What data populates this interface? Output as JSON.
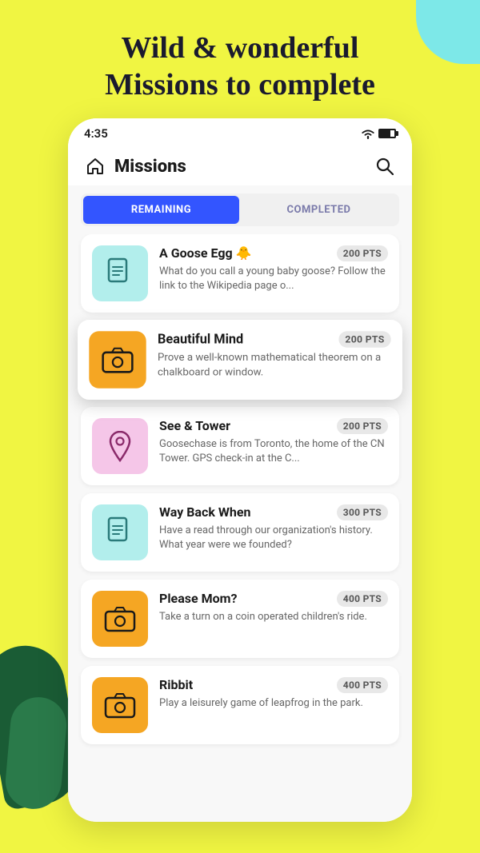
{
  "page": {
    "background_color": "#f0f542",
    "header": {
      "title_line1": "Wild & wonderful",
      "title_line2": "Missions to complete"
    },
    "status_bar": {
      "time": "4:35"
    },
    "app_header": {
      "title": "Missions"
    },
    "tabs": {
      "remaining_label": "REMAINING",
      "completed_label": "COMPLETED",
      "active": "remaining"
    },
    "missions": [
      {
        "id": "goose-egg",
        "title": "A Goose Egg 🐥",
        "pts": "200 PTS",
        "description": "What do you call a young baby goose? Follow the link to the Wikipedia page o...",
        "icon_type": "document",
        "icon_bg": "teal",
        "highlighted": false
      },
      {
        "id": "beautiful-mind",
        "title": "Beautiful Mind",
        "pts": "200 PTS",
        "description": "Prove a well-known mathematical theorem on a chalkboard or window.",
        "icon_type": "camera",
        "icon_bg": "orange",
        "highlighted": true
      },
      {
        "id": "see-tower",
        "title": "See & Tower",
        "pts": "200 PTS",
        "description": "Goosechase is from Toronto, the home of the CN Tower. GPS check-in at the C...",
        "icon_type": "location",
        "icon_bg": "pink",
        "highlighted": false
      },
      {
        "id": "way-back-when",
        "title": "Way Back When",
        "pts": "300 PTS",
        "description": "Have a read through our organization's history. What year were we founded?",
        "icon_type": "document",
        "icon_bg": "teal",
        "highlighted": false
      },
      {
        "id": "please-mom",
        "title": "Please Mom?",
        "pts": "400 PTS",
        "description": "Take a turn on a coin operated children's ride.",
        "icon_type": "camera",
        "icon_bg": "orange",
        "highlighted": false
      },
      {
        "id": "ribbit",
        "title": "Ribbit",
        "pts": "400 PTS",
        "description": "Play a leisurely game of leapfrog in the park.",
        "icon_type": "camera",
        "icon_bg": "orange",
        "highlighted": false
      }
    ]
  }
}
